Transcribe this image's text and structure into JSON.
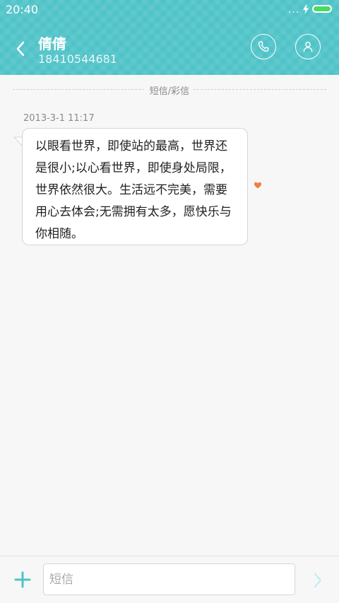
{
  "status_bar": {
    "time": "20:40",
    "dots": "...",
    "icons": [
      "charging-bolt-icon",
      "battery-icon"
    ],
    "battery_color": "#4cd964",
    "battery_level": 1.0
  },
  "header": {
    "background": "#4ec3c8",
    "contact_name": "倩倩",
    "contact_number": "18410544681",
    "back_icon": "chevron-left-icon",
    "call_icon": "phone-icon",
    "profile_icon": "person-icon"
  },
  "conversation": {
    "type_label": "短信/彩信",
    "messages": [
      {
        "timestamp": "2013-3-1 11:17",
        "text": "以眼看世界，即使站的最高，世界还是很小;以心看世界，即使身处局限，世界依然很大。生活远不完美，需要用心去体会;无需拥有太多，愿快乐与你相随。",
        "favorite_icon": "heart-icon",
        "favorite_color": "#f08040"
      }
    ]
  },
  "composer": {
    "placeholder": "短信",
    "value": "",
    "add_icon": "plus-icon",
    "send_icon": "chevron-right-icon",
    "accent": "#4ec3c8"
  }
}
